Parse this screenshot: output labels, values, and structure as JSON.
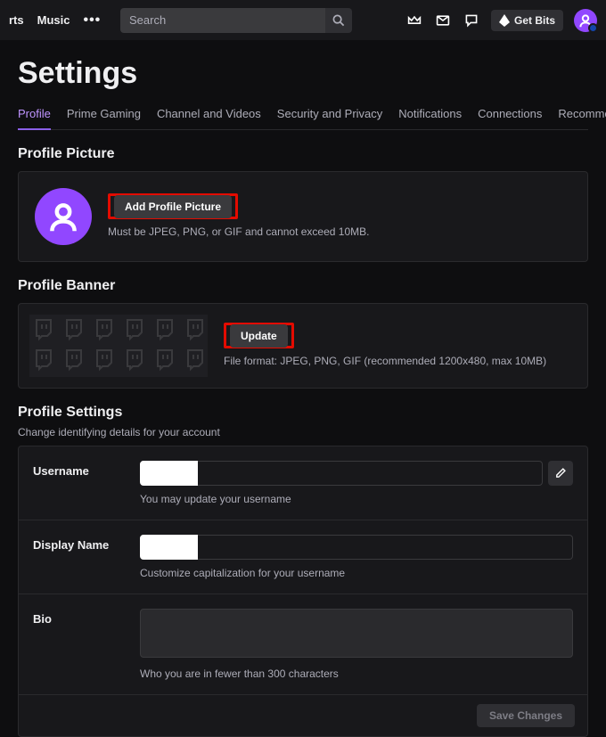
{
  "topbar": {
    "nav_left": [
      "rts",
      "Music"
    ],
    "search_placeholder": "Search",
    "getbits_label": "Get Bits"
  },
  "page_title": "Settings",
  "tabs": [
    "Profile",
    "Prime Gaming",
    "Channel and Videos",
    "Security and Privacy",
    "Notifications",
    "Connections",
    "Recommendations"
  ],
  "profile_picture": {
    "title": "Profile Picture",
    "button": "Add Profile Picture",
    "hint": "Must be JPEG, PNG, or GIF and cannot exceed 10MB."
  },
  "profile_banner": {
    "title": "Profile Banner",
    "button": "Update",
    "hint": "File format: JPEG, PNG, GIF (recommended 1200x480, max 10MB)"
  },
  "profile_settings": {
    "title": "Profile Settings",
    "subtitle": "Change identifying details for your account",
    "rows": {
      "username": {
        "label": "Username",
        "hint": "You may update your username"
      },
      "display_name": {
        "label": "Display Name",
        "hint": "Customize capitalization for your username"
      },
      "bio": {
        "label": "Bio",
        "hint": "Who you are in fewer than 300 characters"
      }
    },
    "save_label": "Save Changes"
  }
}
